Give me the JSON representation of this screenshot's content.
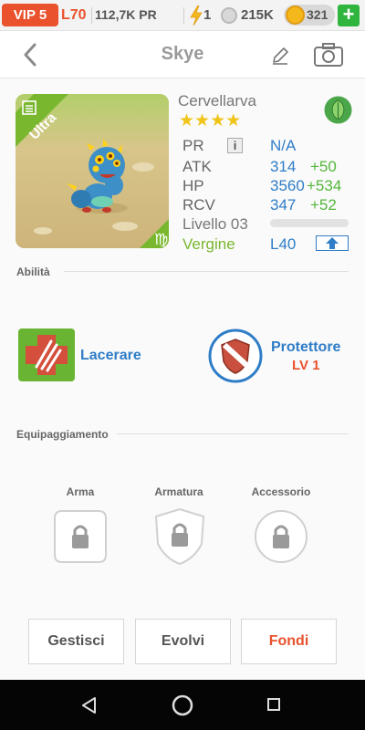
{
  "status_bar": {
    "vip": "VIP 5",
    "level": "L70",
    "pr_value": "112,7K PR",
    "energy": "1",
    "food": "215K",
    "coins": "321",
    "add_symbol": "+"
  },
  "header": {
    "title": "Skye"
  },
  "monster": {
    "name": "Cervellarva",
    "rarity_badge": "Ultra",
    "star_count": 4,
    "stars": "★★★★",
    "element_icon": "leaf-icon",
    "zodiac_icon": "virgo-icon",
    "stats": [
      {
        "label": "PR",
        "value": "N/A",
        "bonus": ""
      },
      {
        "label": "ATK",
        "value": "314",
        "bonus": "+50"
      },
      {
        "label": "HP",
        "value": "3560",
        "bonus": "+534"
      },
      {
        "label": "RCV",
        "value": "347",
        "bonus": "+52"
      }
    ],
    "level_label": "Livello 03",
    "zodiac_label": "Vergine",
    "max_level": "L40",
    "xp_fraction": 0
  },
  "abilities": {
    "section_title": "Abilità",
    "items": [
      {
        "name": "Lacerare",
        "level": ""
      },
      {
        "name": "Protettore",
        "level": "LV 1"
      }
    ]
  },
  "equipment": {
    "section_title": "Equipaggiamento",
    "slots": [
      {
        "label": "Arma"
      },
      {
        "label": "Armatura"
      },
      {
        "label": "Accessorio"
      }
    ]
  },
  "actions": {
    "manage": "Gestisci",
    "evolve": "Evolvi",
    "merge": "Fondi"
  },
  "colors": {
    "accent_red": "#e9522d",
    "stat_blue": "#2f7dc7",
    "bonus_green": "#55b63b",
    "star_yellow": "#f0c419"
  }
}
